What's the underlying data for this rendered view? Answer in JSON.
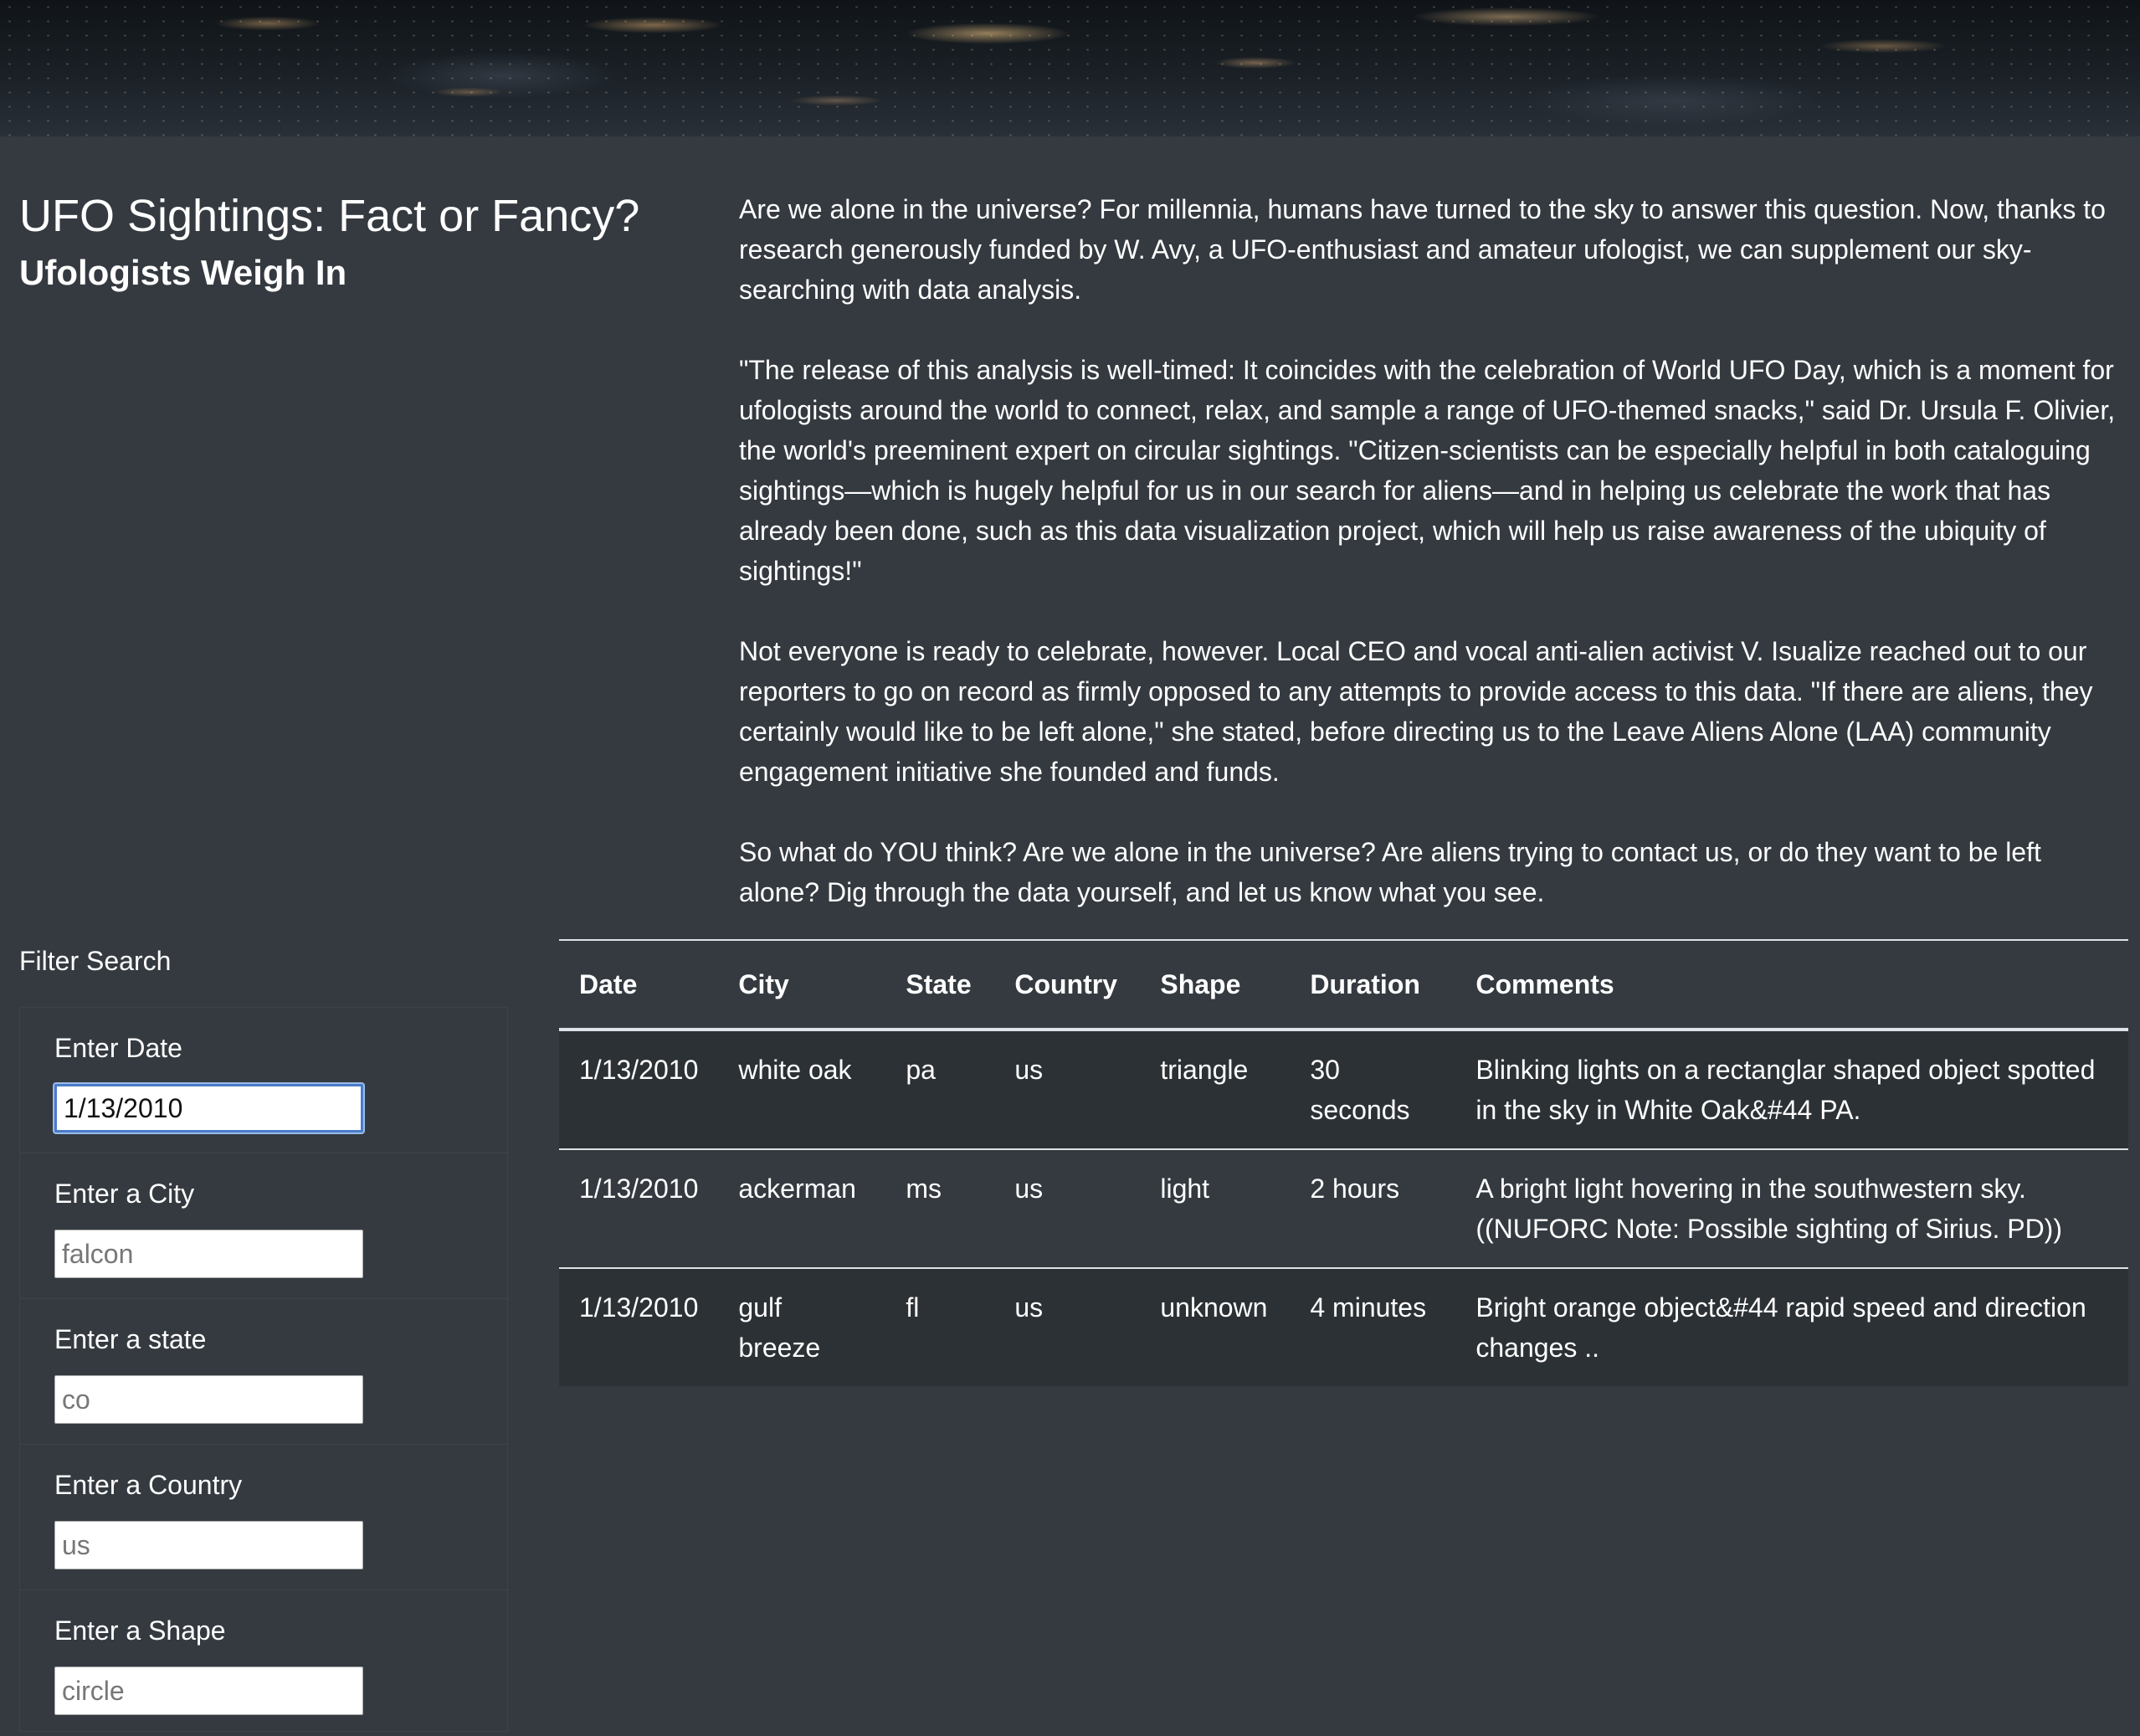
{
  "hero": {
    "image": "earth-night-lights-banner"
  },
  "header": {
    "title": "UFO Sightings: Fact or Fancy?",
    "subtitle": "Ufologists Weigh In"
  },
  "article": {
    "paragraphs": [
      "Are we alone in the universe? For millennia, humans have turned to the sky to answer this question. Now, thanks to research generously funded by W. Avy, a UFO-enthusiast and amateur ufologist, we can supplement our sky-searching with data analysis.",
      "\"The release of this analysis is well-timed: It coincides with the celebration of World UFO Day, which is a moment for ufologists around the world to connect, relax, and sample a range of UFO-themed snacks,\" said Dr. Ursula F. Olivier, the world's preeminent expert on circular sightings. \"Citizen-scientists can be especially helpful in both cataloguing sightings—which is hugely helpful for us in our search for aliens—and in helping us celebrate the work that has already been done, such as this data visualization project, which will help us raise awareness of the ubiquity of sightings!\"",
      "Not everyone is ready to celebrate, however. Local CEO and vocal anti-alien activist V. Isualize reached out to our reporters to go on record as firmly opposed to any attempts to provide access to this data. \"If there are aliens, they certainly would like to be left alone,\" she stated, before directing us to the Leave Aliens Alone (LAA) community engagement initiative she founded and funds.",
      "So what do YOU think? Are we alone in the universe? Are aliens trying to contact us, or do they want to be left alone? Dig through the data yourself, and let us know what you see."
    ]
  },
  "filters": {
    "heading": "Filter Search",
    "items": [
      {
        "label": "Enter Date",
        "value": "1/13/2010",
        "placeholder": ""
      },
      {
        "label": "Enter a City",
        "value": "",
        "placeholder": "falcon"
      },
      {
        "label": "Enter a state",
        "value": "",
        "placeholder": "co"
      },
      {
        "label": "Enter a Country",
        "value": "",
        "placeholder": "us"
      },
      {
        "label": "Enter a Shape",
        "value": "",
        "placeholder": "circle"
      }
    ]
  },
  "table": {
    "headers": [
      "Date",
      "City",
      "State",
      "Country",
      "Shape",
      "Duration",
      "Comments"
    ],
    "rows": [
      [
        "1/13/2010",
        "white oak",
        "pa",
        "us",
        "triangle",
        "30 seconds",
        "Blinking lights on a rectanglar shaped object spotted in the sky in White Oak&#44 PA."
      ],
      [
        "1/13/2010",
        "ackerman",
        "ms",
        "us",
        "light",
        "2 hours",
        "A bright light hovering in the southwestern sky. ((NUFORC Note: Possible sighting of Sirius. PD))"
      ],
      [
        "1/13/2010",
        "gulf breeze",
        "fl",
        "us",
        "unknown",
        "4 minutes",
        "Bright orange object&#44 rapid speed and direction changes .."
      ]
    ]
  }
}
